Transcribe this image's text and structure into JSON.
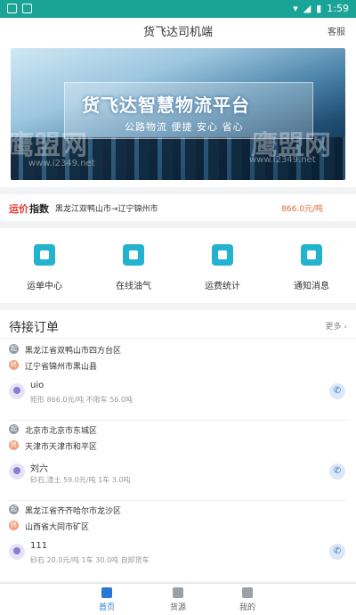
{
  "status_bar": {
    "time": "1:59"
  },
  "header": {
    "title": "货飞达司机端",
    "service_label": "客服"
  },
  "banner": {
    "headline": "货飞达智慧物流平台",
    "subline": "公路物流 便捷 安心 省心",
    "watermark": "鹰盟网",
    "watermark_url": "www.i2349.net"
  },
  "freight_index": {
    "badge_part1": "运价",
    "badge_part2": "指数",
    "route": "黑龙江双鸭山市→辽宁锦州市",
    "price": "866.0元/吨"
  },
  "menu": {
    "items": [
      {
        "label": "运单中心",
        "icon": "waybill-icon"
      },
      {
        "label": "在线油气",
        "icon": "gas-station-icon"
      },
      {
        "label": "运费统计",
        "icon": "statistics-icon"
      },
      {
        "label": "通知消息",
        "icon": "notification-icon"
      }
    ]
  },
  "orders": {
    "title": "待接订单",
    "more_label": "更多",
    "start_marker": "起",
    "end_marker": "终",
    "items": [
      {
        "from": "黑龙江省双鸭山市四方台区",
        "to": "辽宁省锦州市黑山县",
        "name": "uio",
        "detail": "矩形 866.0元/吨 不限车 56.0吨"
      },
      {
        "from": "北京市北京市东城区",
        "to": "天津市天津市和平区",
        "name": "刘六",
        "detail": "砂石,渣土 59.0元/吨 1车 3.0吨"
      },
      {
        "from": "黑龙江省齐齐哈尔市龙沙区",
        "to": "山西省大同市矿区",
        "name": "111",
        "detail": "砂石 20.0元/吨 1车 30.0吨 自卸货车"
      }
    ]
  },
  "tabbar": {
    "items": [
      {
        "label": "首页",
        "icon": "home-icon",
        "active": true
      },
      {
        "label": "货源",
        "icon": "truck-icon",
        "active": false
      },
      {
        "label": "我的",
        "icon": "user-icon",
        "active": false
      }
    ]
  },
  "colors": {
    "accent": "#1aa497",
    "primary": "#2a78d6",
    "price": "#e8662f"
  }
}
